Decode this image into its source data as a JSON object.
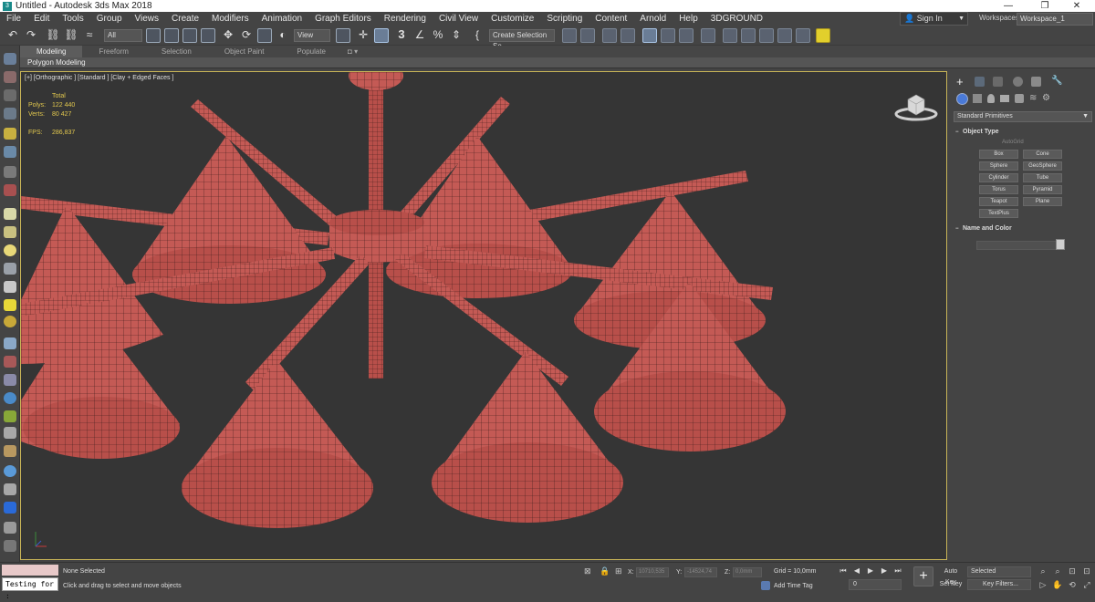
{
  "window": {
    "title": "Untitled - Autodesk 3ds Max 2018",
    "app_icon": "3",
    "minimize": "—",
    "maximize": "❐",
    "close": "✕"
  },
  "menu": {
    "items": [
      "File",
      "Edit",
      "Tools",
      "Group",
      "Views",
      "Create",
      "Modifiers",
      "Animation",
      "Graph Editors",
      "Rendering",
      "Civil View",
      "Customize",
      "Scripting",
      "Content",
      "Arnold",
      "Help",
      "3DGROUND"
    ],
    "sign_in": "Sign In",
    "workspaces_label": "Workspaces:",
    "workspace_value": "Workspace_1"
  },
  "toolbar": {
    "filter_value": "All",
    "refcoord_value": "View",
    "selection_set_placeholder": "Create Selection Se",
    "snap_label": "3",
    "move_glyph": "✥"
  },
  "ribbon": {
    "tabs": [
      "Modeling",
      "Freeform",
      "Selection",
      "Object Paint",
      "Populate"
    ],
    "active_tab": "Modeling",
    "sub_label": "Polygon Modeling"
  },
  "viewport": {
    "label": "[+] [Orthographic ] [Standard ] [Clay + Edged Faces ]",
    "stats": {
      "total_label": "Total",
      "polys_label": "Polys:",
      "polys_value": "122 440",
      "verts_label": "Verts:",
      "verts_value": "80 427",
      "fps_label": "FPS:",
      "fps_value": "286,837"
    },
    "model_color": "#c45a55"
  },
  "command_panel": {
    "category": "Standard Primitives",
    "object_type_header": "Object Type",
    "autogrid": "AutoGrid",
    "primitives": [
      "Box",
      "Cone",
      "Sphere",
      "GeoSphere",
      "Cylinder",
      "Tube",
      "Torus",
      "Pyramid",
      "Teapot",
      "Plane",
      "TextPlus"
    ],
    "name_color_header": "Name and Color"
  },
  "status": {
    "maxscript_text": "Testing for :",
    "selection_text": "None Selected",
    "prompt_text": "Click and drag to select and move objects",
    "x_label": "X:",
    "x_value": "10710,535",
    "y_label": "Y:",
    "y_value": "-14524,74",
    "z_label": "Z:",
    "z_value": "0,0mm",
    "grid_text": "Grid = 10,0mm",
    "time_tag": "Add Time Tag",
    "frame_value": "0",
    "auto_key": "Auto Key",
    "set_key": "Set Key",
    "selected_value": "Selected",
    "key_filters": "Key Filters..."
  }
}
